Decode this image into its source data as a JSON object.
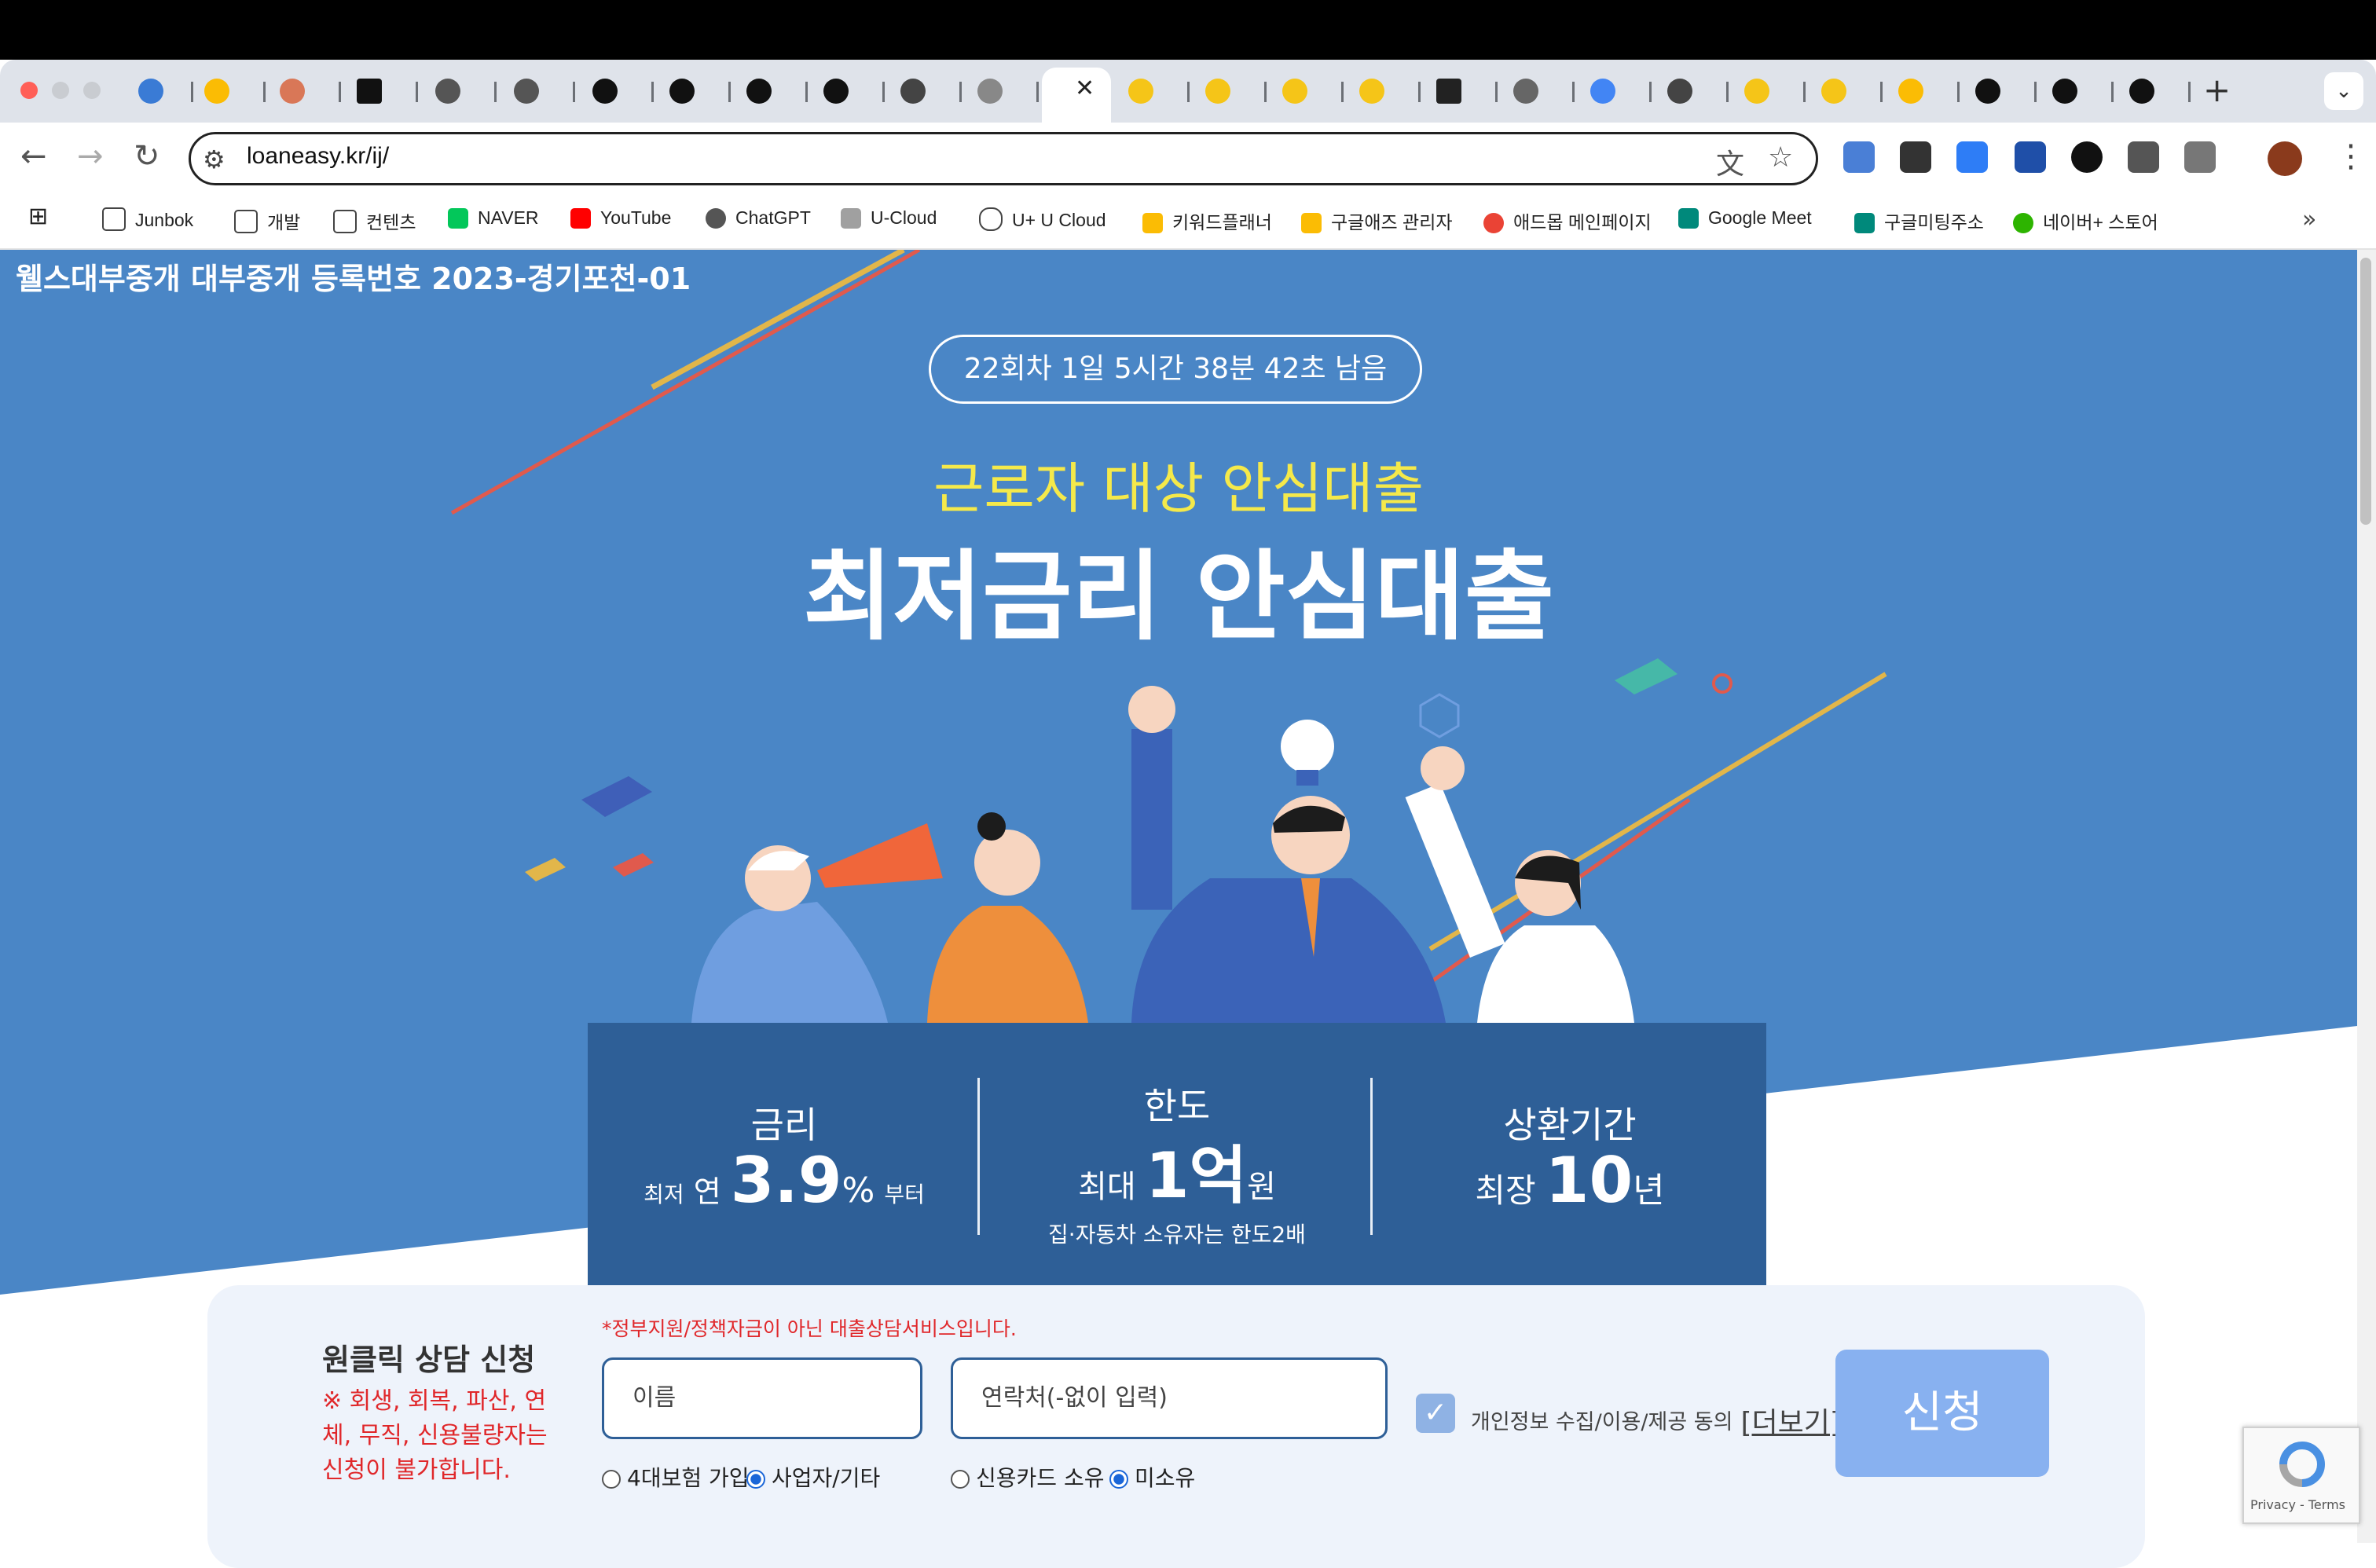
{
  "browser": {
    "url": "loaneasy.kr/ij/",
    "bookmarks": [
      {
        "label": "Junbok",
        "icon": "folder-icon"
      },
      {
        "label": "개발",
        "icon": "folder-icon"
      },
      {
        "label": "컨텐츠",
        "icon": "folder-icon"
      },
      {
        "label": "NAVER",
        "icon": "naver-icon"
      },
      {
        "label": "YouTube",
        "icon": "youtube-icon"
      },
      {
        "label": "ChatGPT",
        "icon": "chatgpt-icon"
      },
      {
        "label": "U-Cloud",
        "icon": "ucloud-icon"
      },
      {
        "label": "U+ U Cloud",
        "icon": "cloud-icon"
      },
      {
        "label": "키워드플래너",
        "icon": "google-ads-icon"
      },
      {
        "label": "구글애즈 관리자",
        "icon": "google-ads-icon"
      },
      {
        "label": "애드몹 메인페이지",
        "icon": "admob-icon"
      },
      {
        "label": "Google Meet",
        "icon": "meet-icon"
      },
      {
        "label": "구글미팅주소",
        "icon": "meet-icon"
      },
      {
        "label": "네이버+ 스토어",
        "icon": "naver-store-icon"
      }
    ]
  },
  "page": {
    "registration": "웰스대부중개 대부중개 등록번호 2023-경기포천-01",
    "countdown": "22회차 1일 5시간 38분 42초 남음",
    "subtitle": "근로자 대상 안심대출",
    "title": "최저금리 안심대출",
    "info": {
      "rate": {
        "head": "금리",
        "pre": "최저",
        "mid": "연",
        "value": "3.9",
        "unit": "%",
        "post": "부터"
      },
      "limit": {
        "head": "한도",
        "pre": "최대",
        "value": "1억",
        "unit": "원",
        "note": "집·자동차 소유자는 한도2배"
      },
      "term": {
        "head": "상환기간",
        "pre": "최장",
        "value": "10",
        "unit": "년"
      }
    },
    "form": {
      "title": "원클릭 상담 신청",
      "warning": "※ 회생, 회복, 파산, 연체, 무직, 신용불량자는 신청이 불가합니다.",
      "notice": "*정부지원/정책자금이 아닌 대출상담서비스입니다.",
      "name_placeholder": "이름",
      "phone_placeholder": "연락처(-없이 입력)",
      "job_options": [
        "4대보험 가입",
        "사업자/기타"
      ],
      "job_selected": "사업자/기타",
      "card_options": [
        "신용카드 소유",
        "미소유"
      ],
      "card_selected": "미소유",
      "agree_label": "개인정보 수집/이용/제공 동의",
      "agree_more": "[더보기]",
      "agree_checked": true,
      "submit": "신청",
      "recaptcha_terms": "Privacy - Terms"
    }
  },
  "colors": {
    "hero_bg": "#4a86c6",
    "info_box": "#2e5f97",
    "subtitle": "#f5e94a",
    "warn": "#e0272a",
    "submit": "#88b1f0"
  }
}
